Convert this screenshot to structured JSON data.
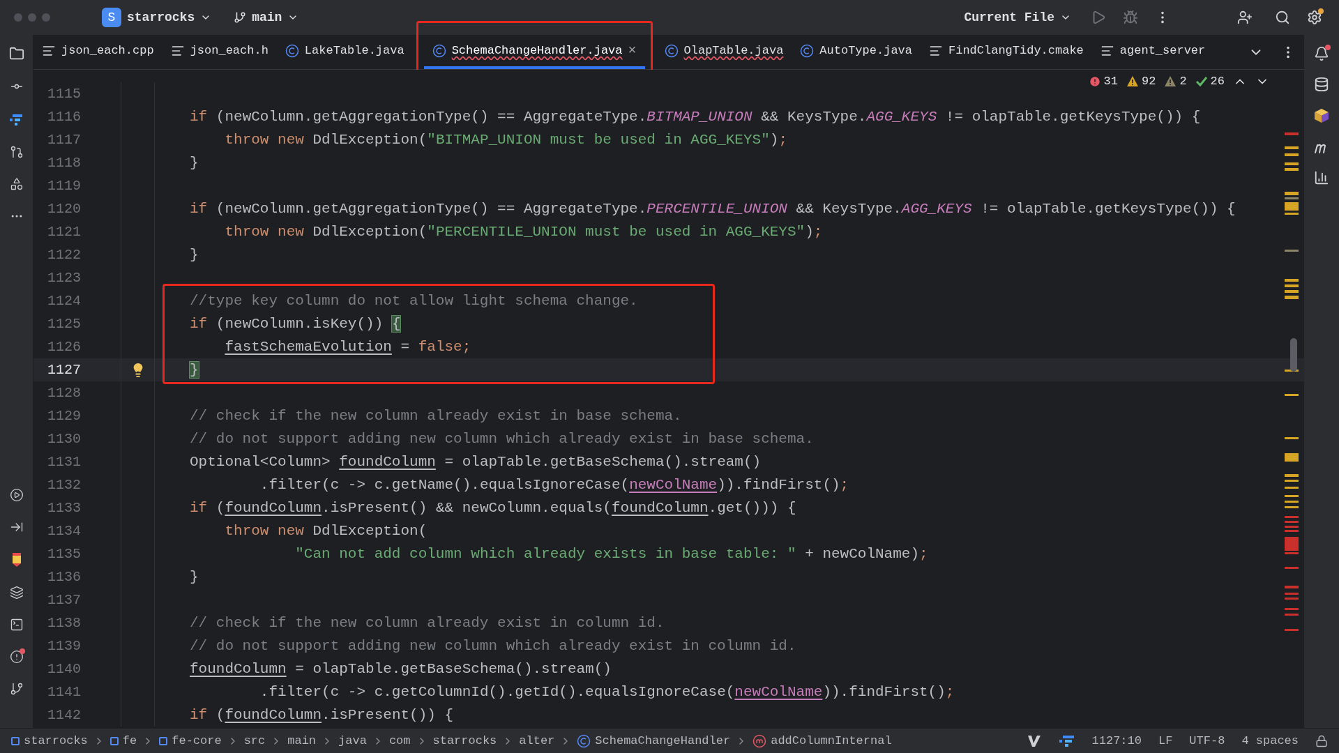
{
  "title_bar": {
    "project_initial": "S",
    "project": "starrocks",
    "branch": "main",
    "run_config": "Current File"
  },
  "tabs": [
    {
      "kind": "text",
      "label": "json_each.cpp",
      "selected": false,
      "error": false,
      "framed": false
    },
    {
      "kind": "text",
      "label": "json_each.h",
      "selected": false,
      "error": false,
      "framed": false
    },
    {
      "kind": "class",
      "label": "LakeTable.java",
      "selected": false,
      "error": false,
      "framed": false
    },
    {
      "kind": "class",
      "label": "SchemaChangeHandler.java",
      "selected": true,
      "error": true,
      "framed": true,
      "close": "×"
    },
    {
      "kind": "class",
      "label": "OlapTable.java",
      "selected": false,
      "error": true,
      "framed": false
    },
    {
      "kind": "class",
      "label": "AutoType.java",
      "selected": false,
      "error": false,
      "framed": false
    },
    {
      "kind": "text",
      "label": "FindClangTidy.cmake",
      "selected": false,
      "error": false,
      "framed": false
    },
    {
      "kind": "text",
      "label": "agent_server",
      "selected": false,
      "error": false,
      "framed": false
    }
  ],
  "inspections": [
    {
      "kind": "error",
      "count": "31"
    },
    {
      "kind": "warning",
      "count": "92"
    },
    {
      "kind": "weak",
      "count": "2"
    },
    {
      "kind": "ok",
      "count": "26"
    }
  ],
  "lines": [
    {
      "number": "1115",
      "current": false,
      "framed": false
    },
    {
      "number": "1116",
      "current": false,
      "framed": false,
      "tokens": [
        {
          "kind": "keyword",
          "text": "if"
        },
        {
          "kind": "plain",
          "text": " (newColumn.getAggregationType() == AggregateType."
        },
        {
          "kind": "constant",
          "text": "BITMAP_UNION"
        },
        {
          "kind": "plain",
          "text": " && KeysType."
        },
        {
          "kind": "constant",
          "text": "AGG_KEYS"
        },
        {
          "kind": "plain",
          "text": " != olapTable.getKeysType()) {"
        }
      ]
    },
    {
      "number": "1117",
      "current": false,
      "framed": false,
      "tokens": [
        {
          "kind": "keyword",
          "text": "    throw new"
        },
        {
          "kind": "plain",
          "text": " DdlException("
        },
        {
          "kind": "string",
          "text": "\"BITMAP_UNION must be used in AGG_KEYS\""
        },
        {
          "kind": "plain",
          "text": ")"
        },
        {
          "kind": "keyword",
          "text": ";"
        }
      ]
    },
    {
      "number": "1118",
      "current": false,
      "framed": false,
      "tokens": [
        {
          "kind": "plain",
          "text": "}"
        }
      ]
    },
    {
      "number": "1119",
      "current": false,
      "framed": false
    },
    {
      "number": "1120",
      "current": false,
      "framed": false,
      "tokens": [
        {
          "kind": "keyword",
          "text": "if"
        },
        {
          "kind": "plain",
          "text": " (newColumn.getAggregationType() == AggregateType."
        },
        {
          "kind": "constant",
          "text": "PERCENTILE_UNION"
        },
        {
          "kind": "plain",
          "text": " && KeysType."
        },
        {
          "kind": "constant",
          "text": "AGG_KEYS"
        },
        {
          "kind": "plain",
          "text": " != olapTable.getKeysType()) {"
        }
      ]
    },
    {
      "number": "1121",
      "current": false,
      "framed": false,
      "tokens": [
        {
          "kind": "keyword",
          "text": "    throw new"
        },
        {
          "kind": "plain",
          "text": " DdlException("
        },
        {
          "kind": "string",
          "text": "\"PERCENTILE_UNION must be used in AGG_KEYS\""
        },
        {
          "kind": "plain",
          "text": ")"
        },
        {
          "kind": "keyword",
          "text": ";"
        }
      ]
    },
    {
      "number": "1122",
      "current": false,
      "framed": false,
      "tokens": [
        {
          "kind": "plain",
          "text": "}"
        }
      ]
    },
    {
      "number": "1123",
      "current": false,
      "framed": false
    },
    {
      "number": "1124",
      "current": false,
      "framed": true,
      "tokens": [
        {
          "kind": "comment",
          "text": "//type key column do not allow light schema change."
        }
      ]
    },
    {
      "number": "1125",
      "current": false,
      "framed": true,
      "tokens": [
        {
          "kind": "keyword",
          "text": "if"
        },
        {
          "kind": "plain",
          "text": " (newColumn.isKey()) "
        },
        {
          "kind": "brace",
          "text": "{"
        }
      ]
    },
    {
      "number": "1126",
      "current": false,
      "framed": true,
      "tokens": [
        {
          "kind": "var",
          "text": "    fastSchemaEvolution"
        },
        {
          "kind": "plain",
          "text": " = "
        },
        {
          "kind": "keyword",
          "text": "false;"
        }
      ]
    },
    {
      "number": "1127",
      "current": true,
      "framed": true,
      "tokens": [
        {
          "kind": "brace",
          "text": "}"
        }
      ]
    },
    {
      "number": "1128",
      "current": false,
      "framed": false
    },
    {
      "number": "1129",
      "current": false,
      "framed": false,
      "tokens": [
        {
          "kind": "comment",
          "text": "// check if the new column already exist in base schema."
        }
      ]
    },
    {
      "number": "1130",
      "current": false,
      "framed": false,
      "tokens": [
        {
          "kind": "comment",
          "text": "// do not support adding new column which already exist in base schema."
        }
      ]
    },
    {
      "number": "1131",
      "current": false,
      "framed": false,
      "tokens": [
        {
          "kind": "plain",
          "text": "Optional<Column> "
        },
        {
          "kind": "var",
          "text": "foundColumn"
        },
        {
          "kind": "plain",
          "text": " = olapTable.getBaseSchema().stream()"
        }
      ]
    },
    {
      "number": "1132",
      "current": false,
      "framed": false,
      "tokens": [
        {
          "kind": "plain",
          "text": "        .filter(c -> c.getName().equalsIgnoreCase("
        },
        {
          "kind": "param",
          "text": "newColName"
        },
        {
          "kind": "plain",
          "text": ")).findFirst()"
        },
        {
          "kind": "keyword",
          "text": ";"
        }
      ]
    },
    {
      "number": "1133",
      "current": false,
      "framed": false,
      "tokens": [
        {
          "kind": "keyword",
          "text": "if"
        },
        {
          "kind": "plain",
          "text": " ("
        },
        {
          "kind": "var",
          "text": "foundColumn"
        },
        {
          "kind": "plain",
          "text": ".isPresent() && newColumn.equals("
        },
        {
          "kind": "var",
          "text": "foundColumn"
        },
        {
          "kind": "plain",
          "text": ".get())) {"
        }
      ]
    },
    {
      "number": "1134",
      "current": false,
      "framed": false,
      "tokens": [
        {
          "kind": "keyword",
          "text": "    throw new"
        },
        {
          "kind": "plain",
          "text": " DdlException("
        }
      ]
    },
    {
      "number": "1135",
      "current": false,
      "framed": false,
      "tokens": [
        {
          "kind": "string",
          "text": "            \"Can not add column which already exists in base table: \""
        },
        {
          "kind": "plain",
          "text": " + newColName)"
        },
        {
          "kind": "keyword",
          "text": ";"
        }
      ]
    },
    {
      "number": "1136",
      "current": false,
      "framed": false,
      "tokens": [
        {
          "kind": "plain",
          "text": "}"
        }
      ]
    },
    {
      "number": "1137",
      "current": false,
      "framed": false
    },
    {
      "number": "1138",
      "current": false,
      "framed": false,
      "tokens": [
        {
          "kind": "comment",
          "text": "// check if the new column already exist in column id."
        }
      ]
    },
    {
      "number": "1139",
      "current": false,
      "framed": false,
      "tokens": [
        {
          "kind": "comment",
          "text": "// do not support adding new column which already exist in column id."
        }
      ]
    },
    {
      "number": "1140",
      "current": false,
      "framed": false,
      "tokens": [
        {
          "kind": "var",
          "text": "foundColumn"
        },
        {
          "kind": "plain",
          "text": " = olapTable.getBaseSchema().stream()"
        }
      ]
    },
    {
      "number": "1141",
      "current": false,
      "framed": false,
      "tokens": [
        {
          "kind": "plain",
          "text": "        .filter(c -> c.getColumnId().getId().equalsIgnoreCase("
        },
        {
          "kind": "param",
          "text": "newColName"
        },
        {
          "kind": "plain",
          "text": ")).findFirst()"
        },
        {
          "kind": "keyword",
          "text": ";"
        }
      ]
    },
    {
      "number": "1142",
      "current": false,
      "framed": false,
      "tokens": [
        {
          "kind": "keyword",
          "text": "if"
        },
        {
          "kind": "plain",
          "text": " ("
        },
        {
          "kind": "var",
          "text": "foundColumn"
        },
        {
          "kind": "plain",
          "text": ".isPresent()) {"
        }
      ]
    }
  ],
  "breadcrumbs": [
    {
      "kind": "module",
      "label": "starrocks"
    },
    {
      "kind": "module",
      "label": "fe"
    },
    {
      "kind": "module",
      "label": "fe-core"
    },
    {
      "kind": "folder",
      "label": "src"
    },
    {
      "kind": "folder",
      "label": "main"
    },
    {
      "kind": "folder",
      "label": "java"
    },
    {
      "kind": "folder",
      "label": "com"
    },
    {
      "kind": "folder",
      "label": "starrocks"
    },
    {
      "kind": "folder",
      "label": "alter"
    },
    {
      "kind": "class",
      "label": "SchemaChangeHandler"
    },
    {
      "kind": "method",
      "label": "addColumnInternal"
    }
  ],
  "status": {
    "position": "1127:10",
    "line_separator": "LF",
    "encoding": "UTF-8",
    "indent": "4 spaces"
  }
}
